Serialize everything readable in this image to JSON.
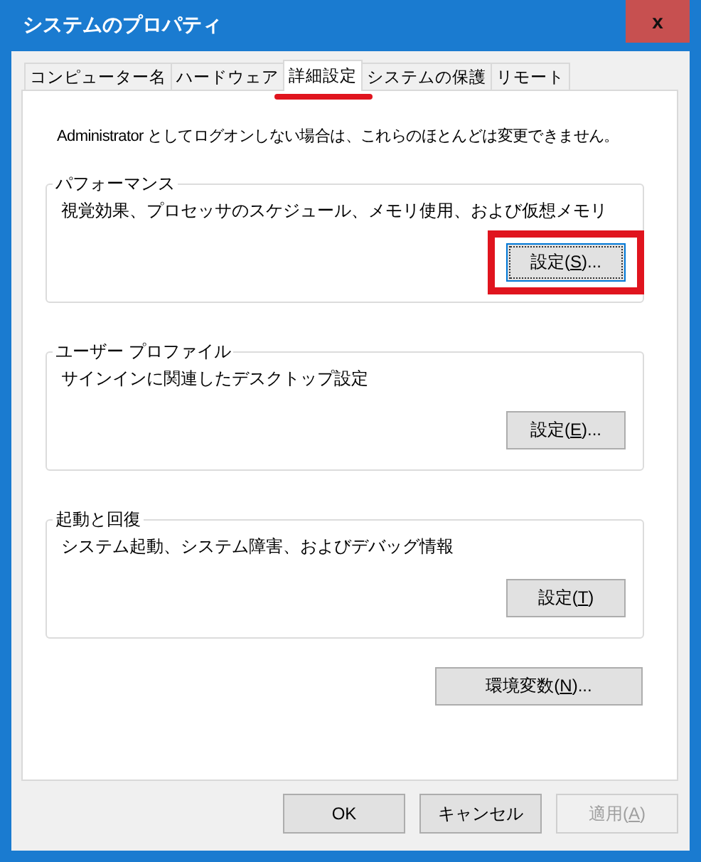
{
  "window": {
    "title": "システムのプロパティ",
    "close": "x"
  },
  "tabs": [
    {
      "label": "コンピューター名",
      "selected": false,
      "annotated": false
    },
    {
      "label": "ハードウェア",
      "selected": false,
      "annotated": false
    },
    {
      "label": "詳細設定",
      "selected": true,
      "annotated": true
    },
    {
      "label": "システムの保護",
      "selected": false,
      "annotated": false
    },
    {
      "label": "リモート",
      "selected": false,
      "annotated": false
    }
  ],
  "notice": "Administrator としてログオンしない場合は、これらのほとんどは変更できません。",
  "groups": [
    {
      "title": "パフォーマンス",
      "description": "視覚効果、プロセッサのスケジュール、メモリ使用、および仮想メモリ",
      "button": {
        "before": "設定(",
        "key": "S",
        "after": ")...",
        "focused": true,
        "annotated": true
      }
    },
    {
      "title": "ユーザー プロファイル",
      "description": "サインインに関連したデスクトップ設定",
      "button": {
        "before": "設定(",
        "key": "E",
        "after": ")...",
        "focused": false,
        "annotated": false
      }
    },
    {
      "title": "起動と回復",
      "description": "システム起動、システム障害、およびデバッグ情報",
      "button": {
        "before": "設定(",
        "key": "T",
        "after": ")",
        "focused": false,
        "annotated": false
      }
    }
  ],
  "env_button": {
    "before": "環境変数(",
    "key": "N",
    "after": ")..."
  },
  "buttons": [
    {
      "before": "OK",
      "disabled": false
    },
    {
      "before": "キャンセル",
      "disabled": false
    },
    {
      "before": "適用(",
      "key": "A",
      "after": ")",
      "disabled": true
    }
  ]
}
